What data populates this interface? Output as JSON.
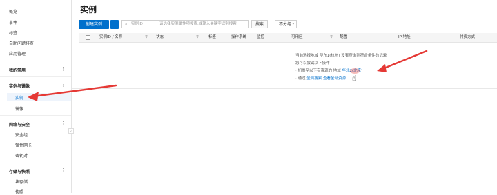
{
  "sidebar": {
    "top_items": [
      "概览",
      "事件",
      "标签",
      "自助问题排查",
      "应用管理"
    ],
    "sections": [
      {
        "title": "我的常用"
      },
      {
        "title": "实例与镜像",
        "items": [
          "实例",
          "镜像"
        ]
      },
      {
        "title": "网络与安全",
        "items": [
          "安全组",
          "弹性网卡",
          "密钥对"
        ]
      },
      {
        "title": "存储与快照",
        "items": [
          "块存储",
          "快照"
        ]
      }
    ],
    "more_icon": "⋮",
    "collapse_icon": "‹"
  },
  "main": {
    "title": "实例",
    "create_button": "创建实例",
    "more_button": "···",
    "search": {
      "filter_label": "实例ID",
      "placeholder": "请选择实例属性项搜索,或输入关键字识别搜索"
    },
    "search_button": "搜索",
    "group_button": "不分组"
  },
  "table": {
    "columns": [
      "实例ID / 名称",
      "状态",
      "标签",
      "操作系统",
      "监控",
      "可用区",
      "配置",
      "IP 地址",
      "付费方式"
    ]
  },
  "empty_state": {
    "line1": "当前选择地域 华东1(杭州) 没有查询到符合条件的记录",
    "line2": "您可以尝试以下操作",
    "line3_prefix": "切换至以下有资源的 地域",
    "line3_region": "华北2(北京)",
    "line4_prefix": "通过",
    "line4_link1": "全局搜索",
    "line4_link2": "查看全部资源"
  },
  "colors": {
    "accent": "#0070cc",
    "annotation": "#e53935"
  }
}
